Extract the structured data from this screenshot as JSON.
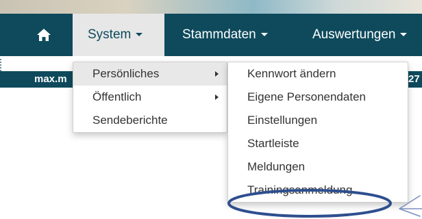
{
  "navbar": {
    "home_icon": "home-icon",
    "items": [
      {
        "label": "System",
        "active": true
      },
      {
        "label": "Stammdaten",
        "active": false
      },
      {
        "label": "Auswertungen",
        "active": false
      }
    ]
  },
  "statusbar": {
    "user_text": "max.m",
    "right_text": "27"
  },
  "system_menu": {
    "items": [
      {
        "label": "Persönliches",
        "has_submenu": true,
        "highlighted": true
      },
      {
        "label": "Öffentlich",
        "has_submenu": true,
        "highlighted": false
      },
      {
        "label": "Sendeberichte",
        "has_submenu": false,
        "highlighted": false
      }
    ]
  },
  "personal_submenu": {
    "items": [
      {
        "label": "Kennwort ändern"
      },
      {
        "label": "Eigene Personendaten"
      },
      {
        "label": "Einstellungen"
      },
      {
        "label": "Startleiste"
      },
      {
        "label": "Meldungen"
      },
      {
        "label": "Trainingsanmeldung",
        "annotated": true
      }
    ]
  },
  "colors": {
    "navbar_bg": "#0e4a5c",
    "annotation": "#2e4f8f"
  }
}
